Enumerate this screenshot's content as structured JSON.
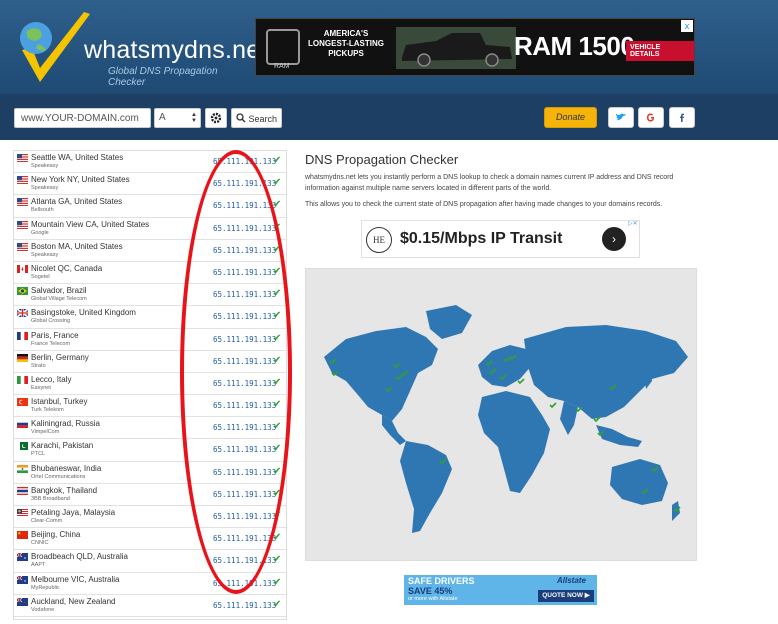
{
  "brand": {
    "name": "whatsmydns.net",
    "tagline": "Global DNS Propagation Checker"
  },
  "top_ad": {
    "headline": "AMERICA'S LONGEST-LASTING PICKUPS",
    "logo_text": "RAM",
    "model": "RAM 1500",
    "cta": "VEHICLE DETAILS",
    "close": "x"
  },
  "toolbar": {
    "domain_value": "www.YOUR-DOMAIN.com",
    "record_type": "A",
    "search_label": "Search",
    "donate_label": "Donate"
  },
  "results": [
    {
      "location": "Seattle WA, United States",
      "isp": "Speakeasy",
      "ip": "65.111.191.133",
      "flag": "us"
    },
    {
      "location": "New York NY, United States",
      "isp": "Speakeasy",
      "ip": "65.111.191.133",
      "flag": "us"
    },
    {
      "location": "Atlanta GA, United States",
      "isp": "Bellsouth",
      "ip": "65.111.191.133",
      "flag": "us"
    },
    {
      "location": "Mountain View CA, United States",
      "isp": "Google",
      "ip": "65.111.191.133",
      "flag": "us"
    },
    {
      "location": "Boston MA, United States",
      "isp": "Speakeasy",
      "ip": "65.111.191.133",
      "flag": "us"
    },
    {
      "location": "Nicolet QC, Canada",
      "isp": "Sogetel",
      "ip": "65.111.191.133",
      "flag": "ca"
    },
    {
      "location": "Salvador, Brazil",
      "isp": "Global Village Telecom",
      "ip": "65.111.191.133",
      "flag": "br"
    },
    {
      "location": "Basingstoke, United Kingdom",
      "isp": "Global Crossing",
      "ip": "65.111.191.133",
      "flag": "gb"
    },
    {
      "location": "Paris, France",
      "isp": "France Telecom",
      "ip": "65.111.191.133",
      "flag": "fr"
    },
    {
      "location": "Berlin, Germany",
      "isp": "Strato",
      "ip": "65.111.191.133",
      "flag": "de"
    },
    {
      "location": "Lecco, Italy",
      "isp": "Easynet",
      "ip": "65.111.191.133",
      "flag": "it"
    },
    {
      "location": "Istanbul, Turkey",
      "isp": "Turk Telekom",
      "ip": "65.111.191.133",
      "flag": "tr"
    },
    {
      "location": "Kaliningrad, Russia",
      "isp": "VimpelCom",
      "ip": "65.111.191.133",
      "flag": "ru"
    },
    {
      "location": "Karachi, Pakistan",
      "isp": "PTCL",
      "ip": "65.111.191.133",
      "flag": "pk"
    },
    {
      "location": "Bhubaneswar, India",
      "isp": "Ortel Communications",
      "ip": "65.111.191.133",
      "flag": "in"
    },
    {
      "location": "Bangkok, Thailand",
      "isp": "3BB Broadband",
      "ip": "65.111.191.133",
      "flag": "th"
    },
    {
      "location": "Petaling Jaya, Malaysia",
      "isp": "Clear-Comm",
      "ip": "65.111.191.133",
      "flag": "my"
    },
    {
      "location": "Beijing, China",
      "isp": "CNNIC",
      "ip": "65.111.191.133",
      "flag": "cn"
    },
    {
      "location": "Broadbeach QLD, Australia",
      "isp": "AAPT",
      "ip": "65.111.191.133",
      "flag": "au"
    },
    {
      "location": "Melbourne VIC, Australia",
      "isp": "MyRepublic",
      "ip": "65.111.191.133",
      "flag": "au"
    },
    {
      "location": "Auckland, New Zealand",
      "isp": "Vodafone",
      "ip": "65.111.191.133",
      "flag": "nz"
    }
  ],
  "main": {
    "title": "DNS Propagation Checker",
    "desc1": "whatsmydns.net lets you instantly perform a DNS lookup to check a domain names current IP address and DNS record information against multiple name servers located in different parts of the world.",
    "desc2": "This allows you to check the current state of DNS propagation after having made changes to your domains records."
  },
  "mid_ad": {
    "logo": "HE",
    "text": "$0.15/Mbps IP Transit"
  },
  "bottom_ad": {
    "line1": "SAFE DRIVERS",
    "line2": "SAVE 45%",
    "line3": "or more with Allstate",
    "brand": "Allstate",
    "cta": "QUOTE NOW ▶"
  },
  "colors": {
    "header": "#2f5f8c",
    "toolbar": "#1d3f63",
    "ip_text": "#1f5ea8",
    "check": "#2ea02e",
    "donate": "#f5b40a",
    "map_land": "#2f77b3",
    "map_ocean": "#e6e6e6",
    "annotation": "#e8141a"
  }
}
